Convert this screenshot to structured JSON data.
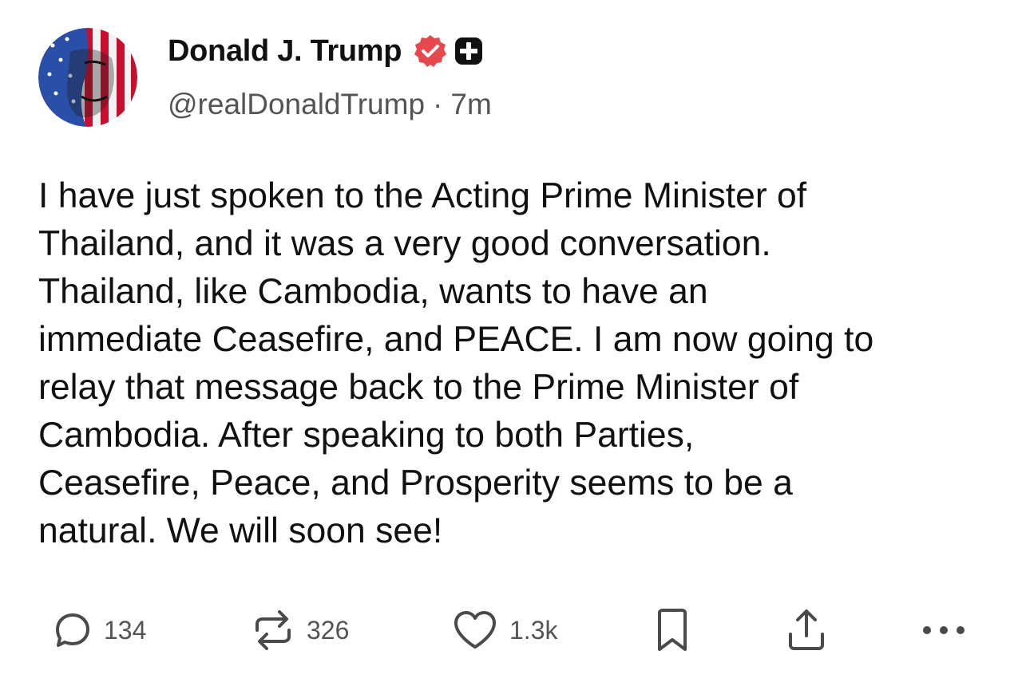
{
  "post": {
    "author": {
      "display_name": "Donald J. Trump",
      "handle": "@realDonaldTrump",
      "verified": true
    },
    "separator": "·",
    "timestamp": "7m",
    "text": "I have just spoken to the Acting Prime Minister of\nThailand, and it was a very good conversation.\nThailand, like Cambodia, wants to have an\nimmediate Ceasefire, and PEACE. I am now going to\nrelay that message back to the Prime Minister of\nCambodia. After speaking to both Parties,\nCeasefire, Peace, and Prosperity seems to be a\nnatural. We will soon see!",
    "actions": {
      "replies": "134",
      "reposts": "326",
      "likes": "1.3k"
    }
  },
  "colors": {
    "text": "#111111",
    "secondary_text": "#545454",
    "verified_badge": "#e5484d",
    "background": "#ffffff"
  },
  "icons": {
    "verified": "verified-badge-icon",
    "plus": "plus-badge-icon",
    "reply": "reply-icon",
    "repost": "repost-icon",
    "like": "heart-icon",
    "bookmark": "bookmark-icon",
    "share": "share-icon",
    "more": "more-icon"
  }
}
